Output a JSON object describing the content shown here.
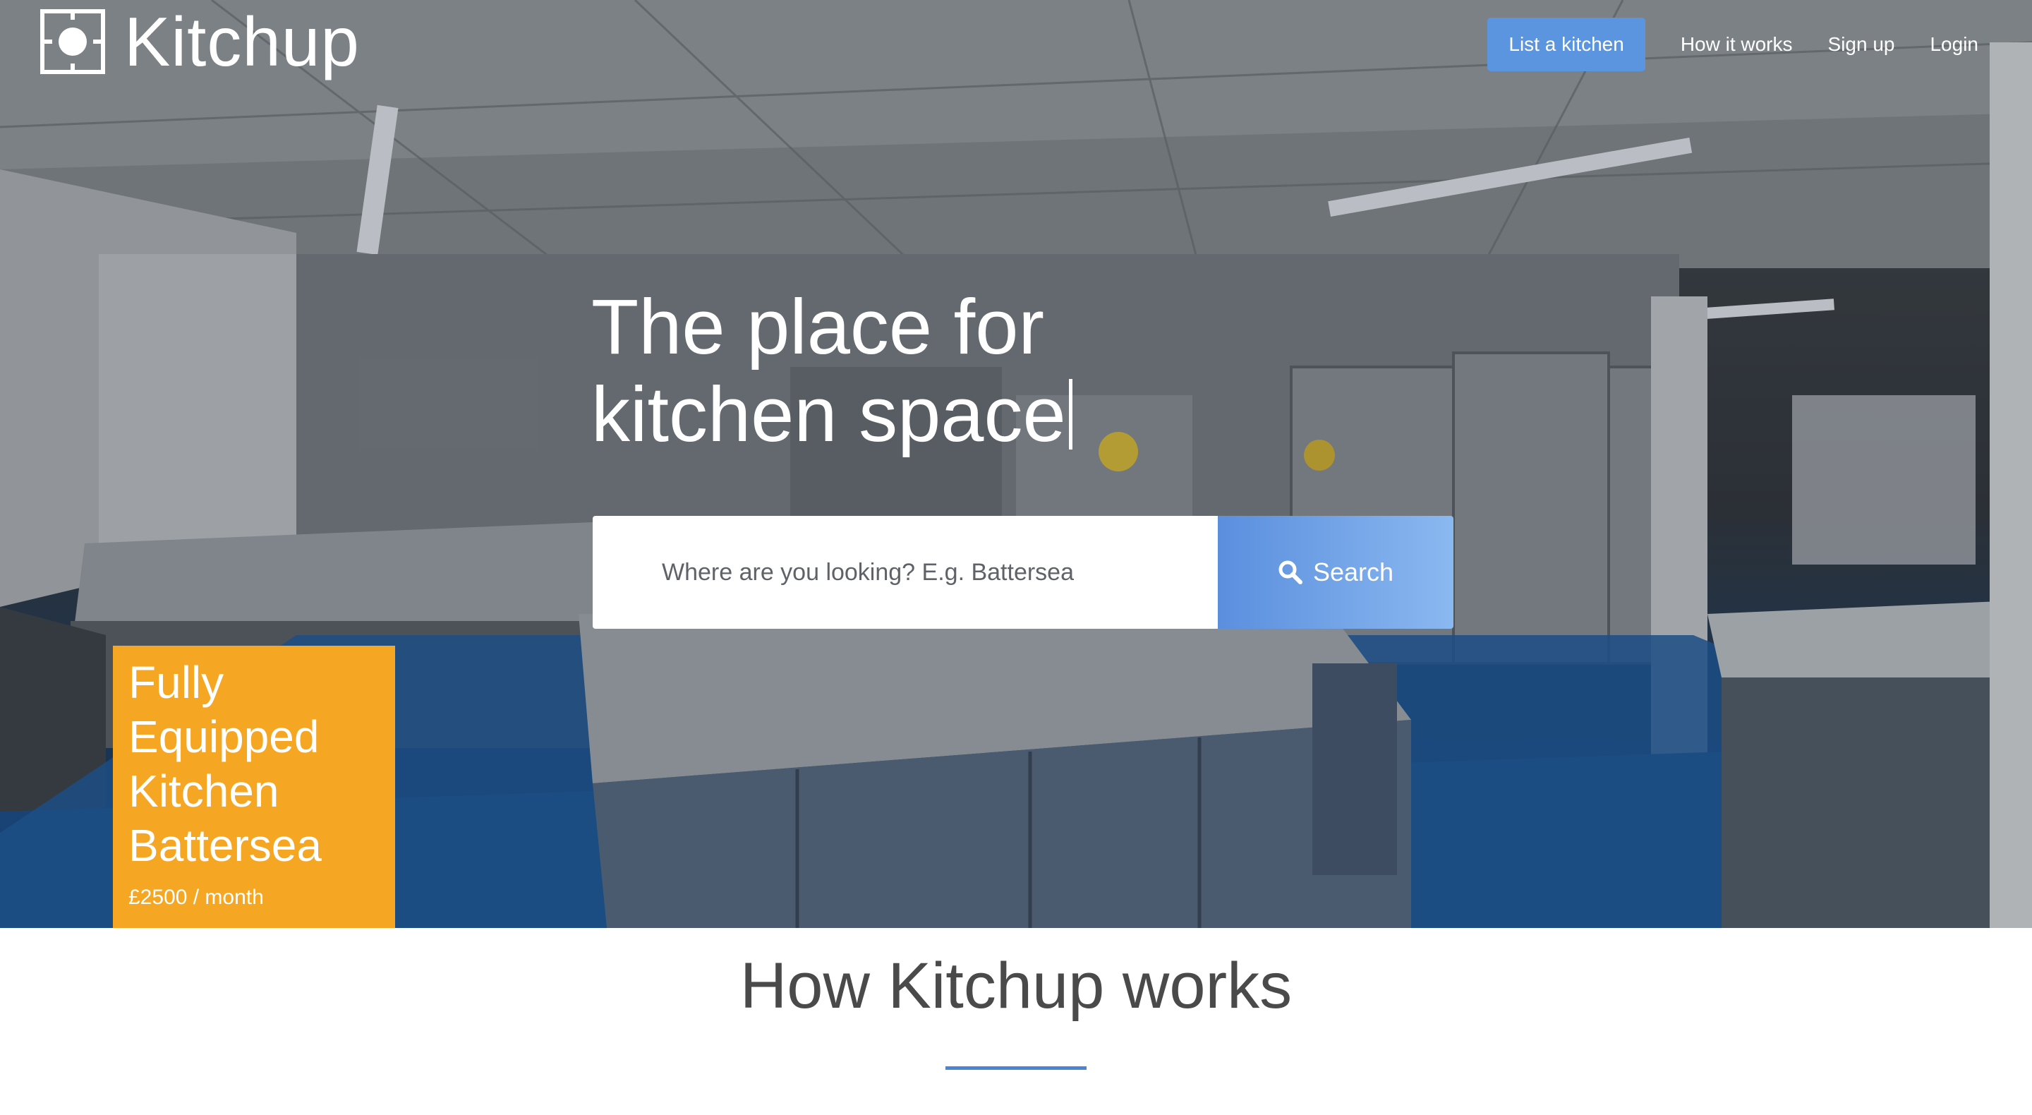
{
  "brand": {
    "name": "Kitchup"
  },
  "nav": {
    "list_kitchen": "List a kitchen",
    "how_it_works": "How it works",
    "sign_up": "Sign up",
    "login": "Login"
  },
  "hero": {
    "headline_line1": "The place for",
    "headline_line2": "kitchen space"
  },
  "search": {
    "placeholder": "Where are you looking? E.g. Battersea",
    "button_label": "Search"
  },
  "featured": {
    "title_lines": [
      "Fully",
      "Equipped",
      "Kitchen",
      "Battersea"
    ],
    "price": "£2500 / month"
  },
  "how": {
    "title": "How Kitchup works"
  },
  "colors": {
    "accent": "#5b95e0",
    "featured": "#f5a623",
    "rule": "#4a86d4"
  },
  "icons": {
    "search": "search-icon",
    "logo": "hob-logo-icon"
  }
}
